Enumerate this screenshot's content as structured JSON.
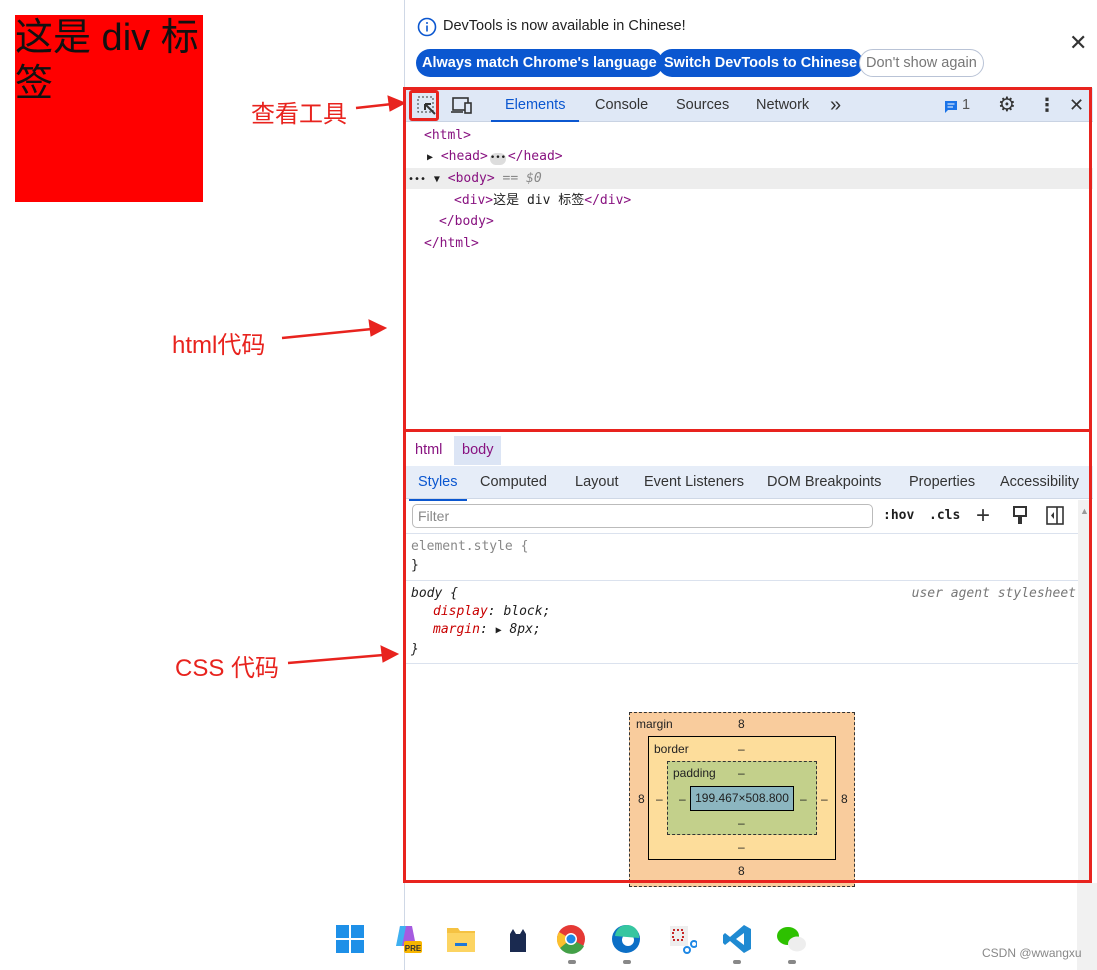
{
  "page": {
    "div_text": "这是 div 标签",
    "div_color": "#ff0000"
  },
  "annotations": {
    "inspect": "查看工具",
    "html": "html代码",
    "css": "CSS 代码",
    "color": "#e8231e"
  },
  "infobar": {
    "message": "DevTools is now available in Chinese!",
    "btn_match": "Always match Chrome's language",
    "btn_switch": "Switch DevTools to Chinese",
    "btn_dont": "Don't show again"
  },
  "toolbar": {
    "tabs": [
      "Elements",
      "Console",
      "Sources",
      "Network"
    ],
    "active": "Elements",
    "more": "»",
    "issues_count": "1"
  },
  "dom": {
    "l1": "<html>",
    "l2a": "<head>",
    "l2b": "</head>",
    "l3": "<body>",
    "l3eq": "== $0",
    "l4a": "<div>",
    "l4t": "这是 div 标签",
    "l4b": "</div>",
    "l5": "</body>",
    "l6": "</html>"
  },
  "breadcrumbs": [
    "html",
    "body"
  ],
  "subtabs": [
    "Styles",
    "Computed",
    "Layout",
    "Event Listeners",
    "DOM Breakpoints",
    "Properties",
    "Accessibility"
  ],
  "styles": {
    "filter_placeholder": "Filter",
    "hov": ":hov",
    "cls": ".cls",
    "element_style": "element.style {",
    "close": "}",
    "body_sel": "body {",
    "ua": "user agent stylesheet",
    "p1": "display",
    "v1": "block;",
    "p2": "margin",
    "v2": "8px;"
  },
  "boxmodel": {
    "margin_label": "margin",
    "border_label": "border",
    "padding_label": "padding",
    "margin_top": "8",
    "margin_bottom": "8",
    "margin_left": "8",
    "margin_right": "8",
    "border": "–",
    "padding": "–",
    "content": "199.467×508.800",
    "colors": {
      "margin": "#f9cc9d",
      "border": "#fddd9b",
      "padding": "#c3d08b",
      "content": "#8cb6c0"
    }
  },
  "taskbar": {
    "icons": [
      "windows-start",
      "copilot-pre",
      "file-explorer",
      "cat-app",
      "chrome",
      "edge",
      "snipping-tool",
      "vscode",
      "wechat"
    ],
    "pre_badge": "PRE"
  },
  "watermark": "CSDN @wwangxu"
}
